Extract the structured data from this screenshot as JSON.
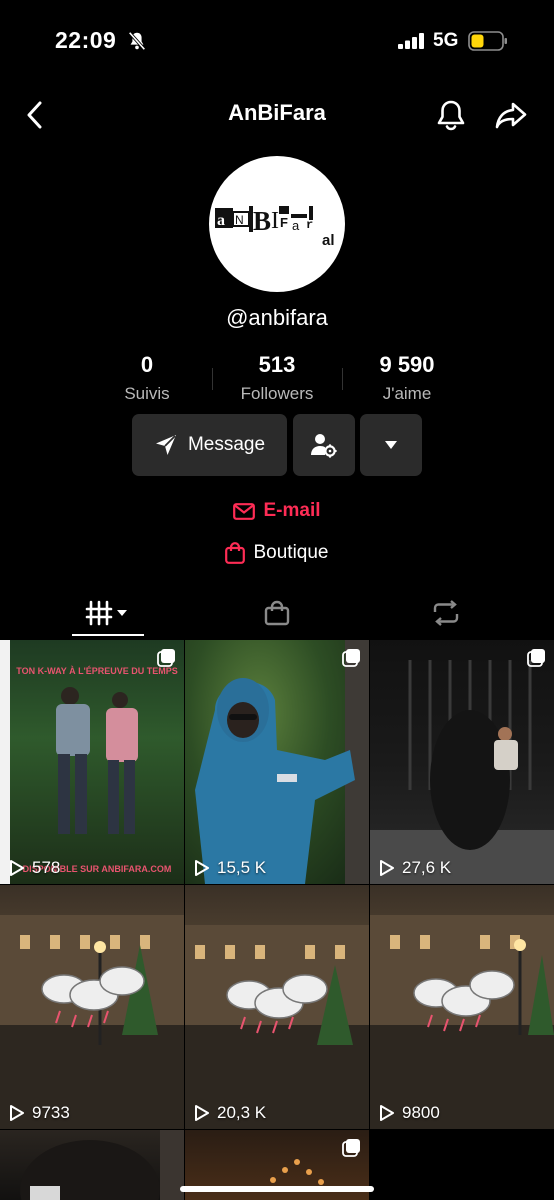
{
  "status_bar": {
    "time": "22:09",
    "network": "5G",
    "icons": [
      "bell-slash-icon",
      "signal-bars-icon",
      "battery-icon"
    ],
    "battery_color": "#ffd60a"
  },
  "header": {
    "title": "AnBiFara",
    "icons": [
      "back-chevron-icon",
      "bell-icon",
      "share-arrow-icon"
    ]
  },
  "profile": {
    "avatar_logo_text": "AnBiFara",
    "username": "@anbifara"
  },
  "stats": [
    {
      "value": "0",
      "label": "Suivis"
    },
    {
      "value": "513",
      "label": "Followers"
    },
    {
      "value": "9 590",
      "label": "J'aime"
    }
  ],
  "actions": {
    "message_label": "Message",
    "icons": [
      "send-icon",
      "user-settings-icon",
      "caret-down-icon"
    ]
  },
  "links": {
    "email_label": "E-mail",
    "shop_label": "Boutique",
    "accent_color": "#fe2c55"
  },
  "tabs": [
    {
      "icon": "grid-icon",
      "selected": true
    },
    {
      "icon": "bag-icon",
      "selected": false
    },
    {
      "icon": "repost-icon",
      "selected": false
    }
  ],
  "videos": [
    {
      "views": "578",
      "overlay_top": "TON K-WAY À L'ÉPREUVE DU TEMPS",
      "overlay_bottom": "DISPONIBLE SUR ANBIFARA.COM",
      "pinned": true
    },
    {
      "views": "15,5 K",
      "pinned": true
    },
    {
      "views": "27,6 K",
      "pinned": true
    },
    {
      "views": "9733",
      "pinned": false
    },
    {
      "views": "20,3 K",
      "pinned": false
    },
    {
      "views": "9800",
      "pinned": false
    },
    {
      "views": "",
      "pinned": false
    },
    {
      "views": "",
      "pinned": true
    }
  ]
}
